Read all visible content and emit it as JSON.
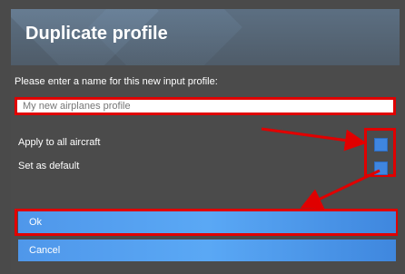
{
  "dialog": {
    "title": "Duplicate profile",
    "prompt": "Please enter a name for this new input profile:",
    "name_input": {
      "value": "My new airplanes profile"
    },
    "options": [
      {
        "label": "Apply to all aircraft",
        "checked": true
      },
      {
        "label": "Set as default",
        "checked": true
      }
    ],
    "ok_label": "Ok",
    "cancel_label": "Cancel"
  },
  "colors": {
    "annotation": "#e00000",
    "accent": "#3f86e0",
    "dialog_bg": "#4b4b4b"
  }
}
